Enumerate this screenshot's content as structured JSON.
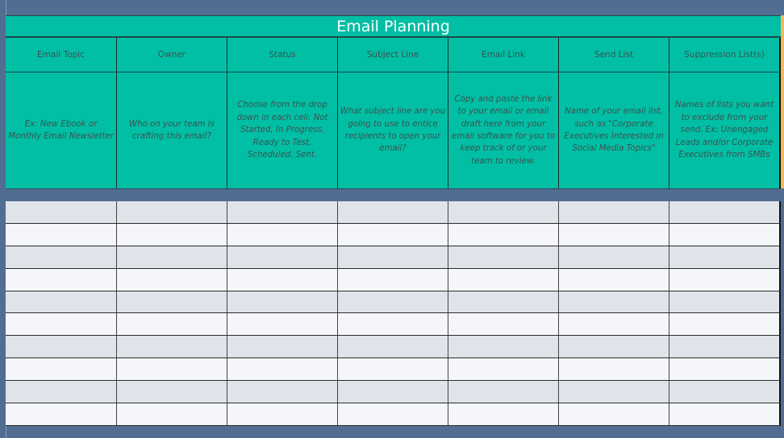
{
  "sheet": {
    "title": "Email Planning",
    "columns": [
      {
        "header": "Email Topic",
        "description": "Ex: New Ebook or Monthly Email Newsletter"
      },
      {
        "header": "Owner",
        "description": "Who on your team is crafting this email?"
      },
      {
        "header": "Status",
        "description": "Choose from the drop down in each cell: Not Started, In Progress, Ready to Test, Scheduled, Sent."
      },
      {
        "header": "Subject Line",
        "description": "What subject line are you going to use to entice recipients to open your email?"
      },
      {
        "header": "Email Link",
        "description": "Copy and paste the link to your email or email draft here from your email software for you to keep track of or your team to review."
      },
      {
        "header": "Send List",
        "description": "Name of your email list, such as \"Corporate Executives Interested in Social Media Topics\""
      },
      {
        "header": "Suppression List(s)",
        "description": "Names of lists you want to exclude from your send. Ex: Unengaged Leads and/or Corporate Executives from SMBs"
      }
    ],
    "rows": [
      [
        "",
        "",
        "",
        "",
        "",
        "",
        ""
      ],
      [
        "",
        "",
        "",
        "",
        "",
        "",
        ""
      ],
      [
        "",
        "",
        "",
        "",
        "",
        "",
        ""
      ],
      [
        "",
        "",
        "",
        "",
        "",
        "",
        ""
      ],
      [
        "",
        "",
        "",
        "",
        "",
        "",
        ""
      ],
      [
        "",
        "",
        "",
        "",
        "",
        "",
        ""
      ],
      [
        "",
        "",
        "",
        "",
        "",
        "",
        ""
      ],
      [
        "",
        "",
        "",
        "",
        "",
        "",
        ""
      ],
      [
        "",
        "",
        "",
        "",
        "",
        "",
        ""
      ],
      [
        "",
        "",
        "",
        "",
        "",
        "",
        ""
      ]
    ]
  },
  "colors": {
    "header_teal": "#00bfa5",
    "band_slate": "#516e92",
    "row_odd": "#dfe3ea",
    "row_even": "#f4f6f9",
    "accent_orange": "#f0b95c"
  }
}
